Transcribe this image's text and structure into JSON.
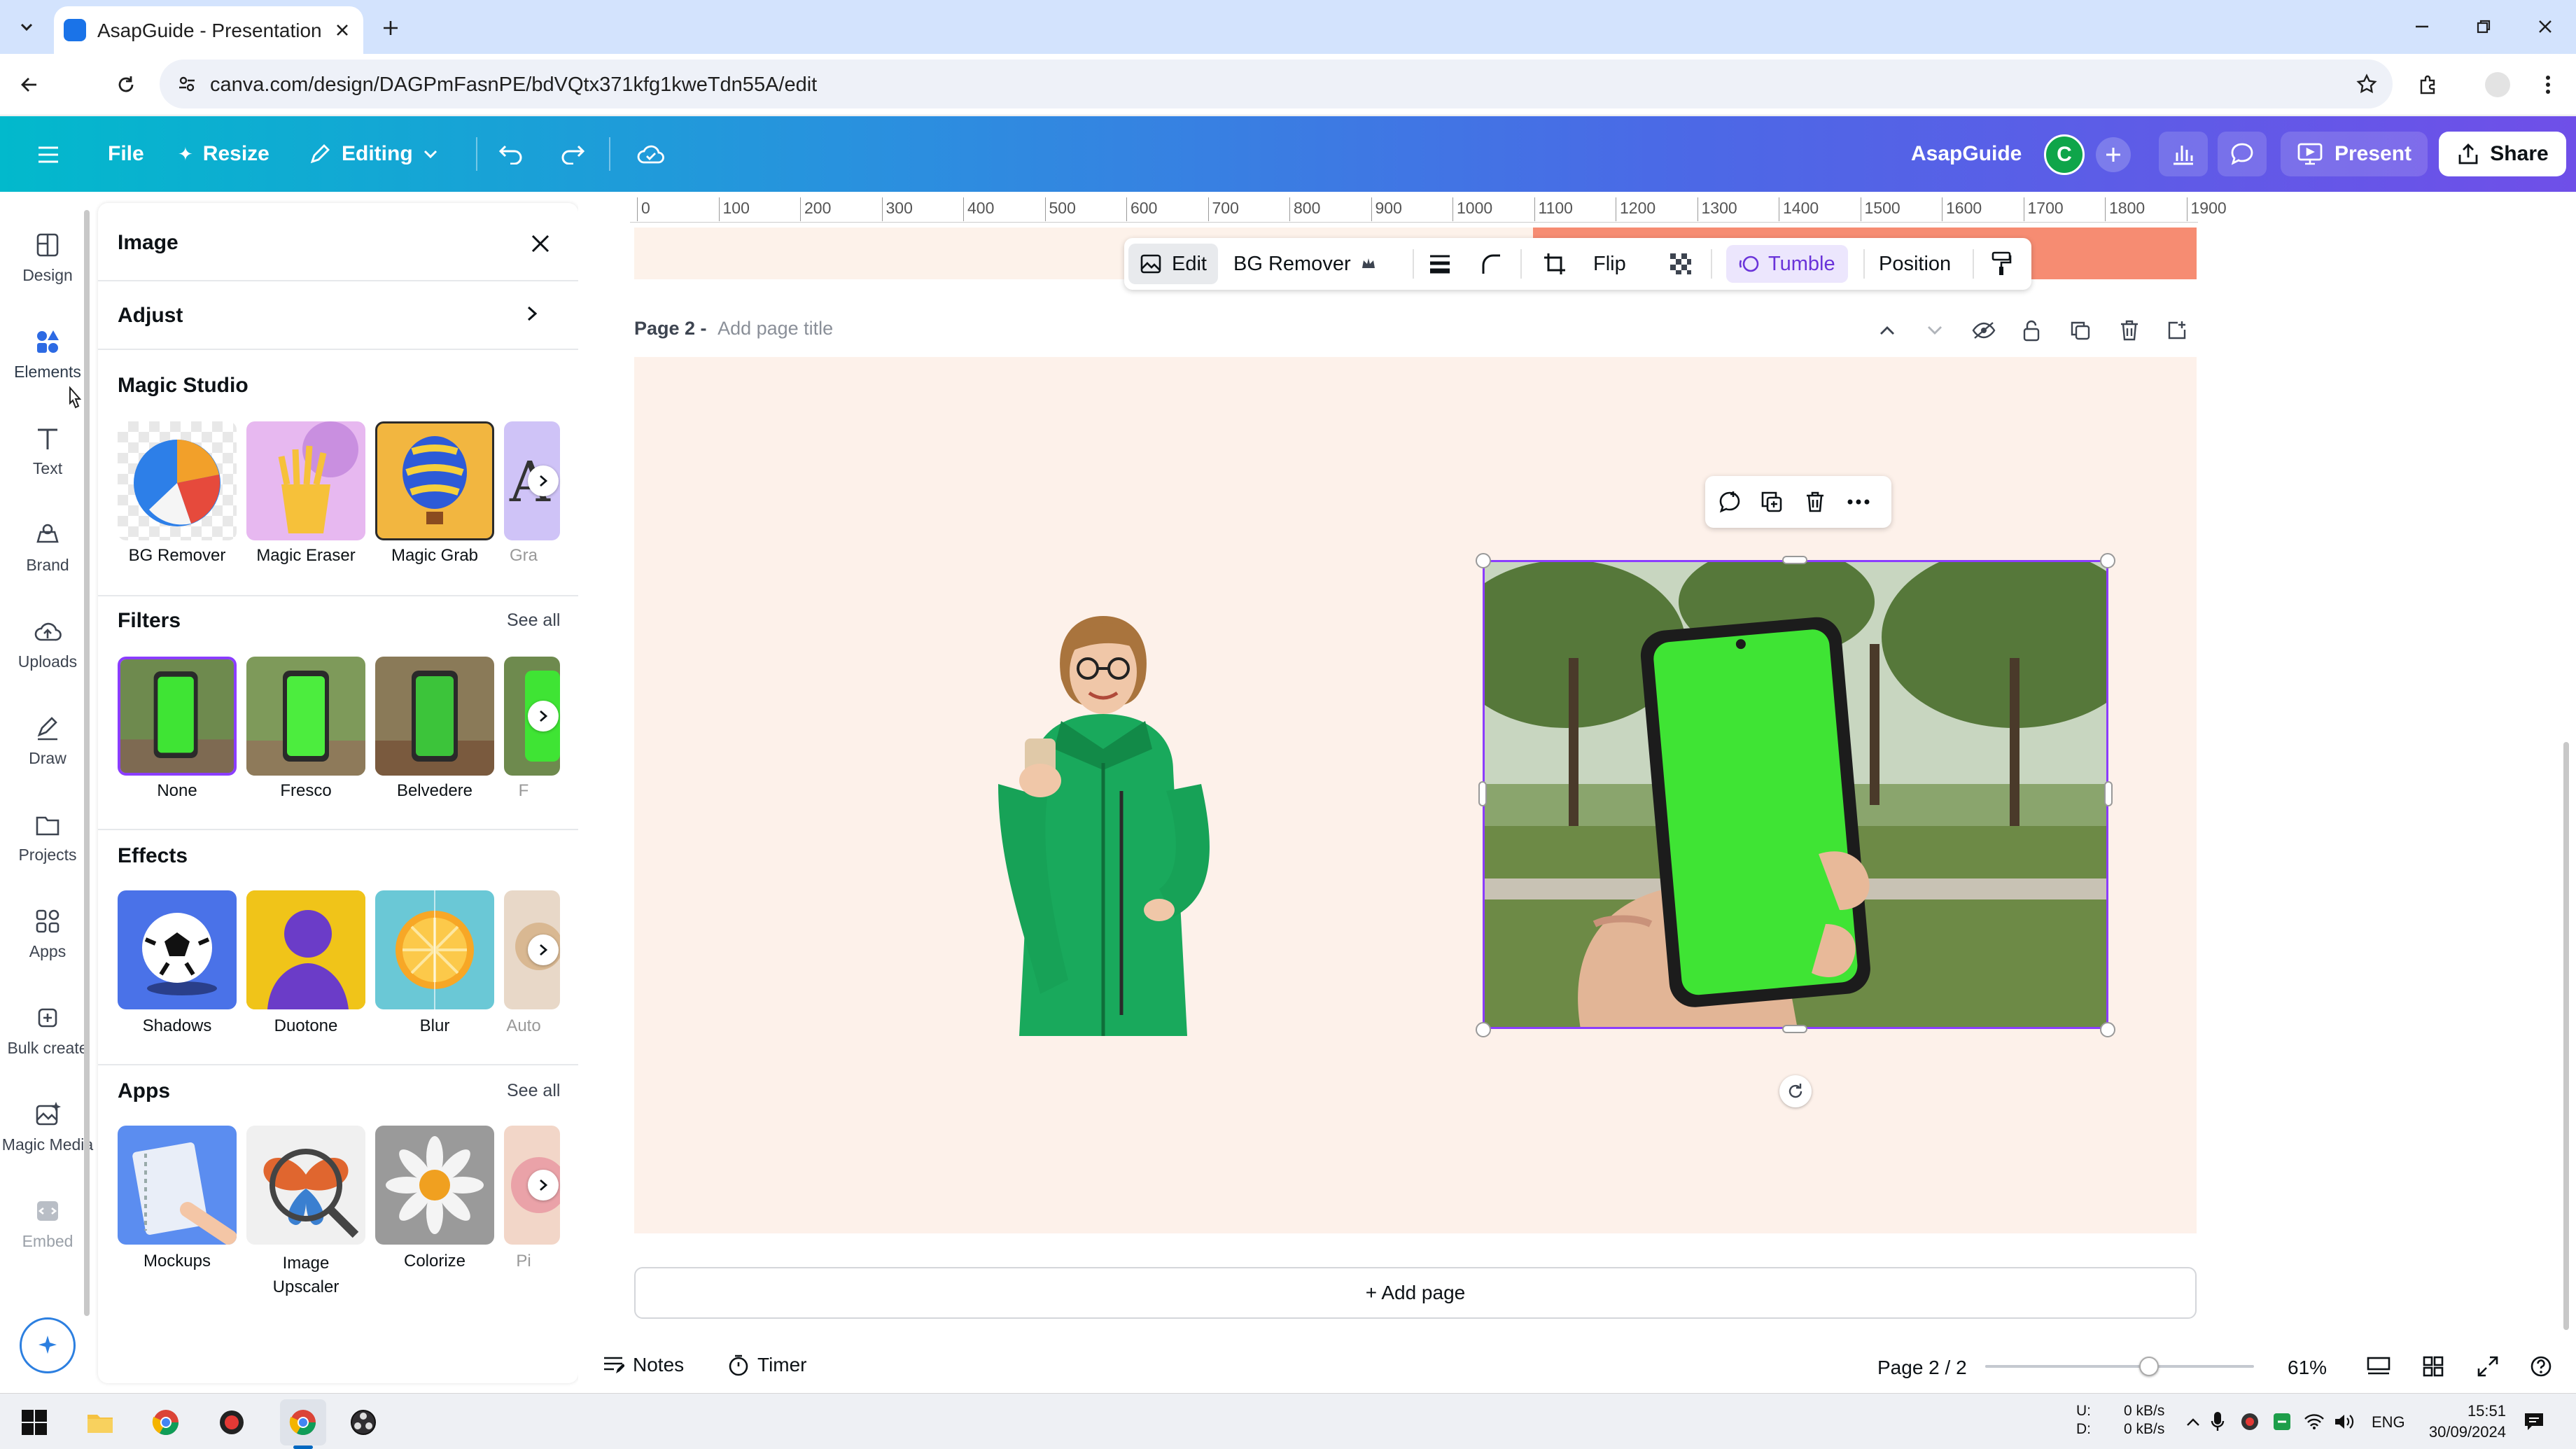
{
  "browser": {
    "tab_title": "AsapGuide - Presentation",
    "url": "canva.com/design/DAGPmFasnPE/bdVQtx371kfg1kweTdn55A/edit"
  },
  "header": {
    "file": "File",
    "resize": "Resize",
    "editing": "Editing",
    "team": "AsapGuide",
    "avatar_letter": "C",
    "present": "Present",
    "share": "Share"
  },
  "sidebar": {
    "items": [
      {
        "label": "Design",
        "icon": "design-icon"
      },
      {
        "label": "Elements",
        "icon": "elements-icon"
      },
      {
        "label": "Text",
        "icon": "text-icon"
      },
      {
        "label": "Brand",
        "icon": "brand-icon"
      },
      {
        "label": "Uploads",
        "icon": "uploads-icon"
      },
      {
        "label": "Draw",
        "icon": "draw-icon"
      },
      {
        "label": "Projects",
        "icon": "projects-icon"
      },
      {
        "label": "Apps",
        "icon": "apps-icon"
      },
      {
        "label": "Bulk create",
        "icon": "bulk-create-icon"
      },
      {
        "label": "Magic Media",
        "icon": "magic-media-icon"
      },
      {
        "label": "Embed",
        "icon": "embed-icon"
      }
    ]
  },
  "panel": {
    "title": "Image",
    "adjust": "Adjust",
    "magic_studio": {
      "heading": "Magic Studio",
      "items": [
        "BG Remover",
        "Magic Eraser",
        "Magic Grab",
        "Gra"
      ]
    },
    "filters": {
      "heading": "Filters",
      "see_all": "See all",
      "items": [
        "None",
        "Fresco",
        "Belvedere",
        "F"
      ]
    },
    "effects": {
      "heading": "Effects",
      "items": [
        "Shadows",
        "Duotone",
        "Blur",
        "Auto"
      ]
    },
    "apps": {
      "heading": "Apps",
      "see_all": "See all",
      "items": [
        "Mockups",
        "Image Upscaler",
        "Colorize",
        "Pi"
      ]
    }
  },
  "ruler": [
    "0",
    "100",
    "200",
    "300",
    "400",
    "500",
    "600",
    "700",
    "800",
    "900",
    "1000",
    "1100",
    "1200",
    "1300",
    "1400",
    "1500",
    "1600",
    "1700",
    "1800",
    "1900"
  ],
  "context_toolbar": {
    "edit": "Edit",
    "bg_remover": "BG Remover",
    "flip": "Flip",
    "tumble": "Tumble",
    "position": "Position"
  },
  "page": {
    "label": "Page 2 -",
    "title_placeholder": "Add page title"
  },
  "add_page": "+ Add page",
  "bottom": {
    "notes": "Notes",
    "timer": "Timer",
    "page_indicator": "Page 2 / 2",
    "zoom": "61%",
    "zoom_value": 0.61
  },
  "taskbar": {
    "net_up_label": "U:",
    "net_down_label": "D:",
    "net_up": "0 kB/s",
    "net_down": "0 kB/s",
    "lang": "ENG",
    "time": "15:51",
    "date": "30/09/2024"
  },
  "colors": {
    "accent": "#8b3dff",
    "header_start": "#02b9cc",
    "header_end": "#6f4fe8",
    "page_bg": "#fdf1ea",
    "phone_green": "#3fe434",
    "jacket_green": "#19a95c"
  }
}
